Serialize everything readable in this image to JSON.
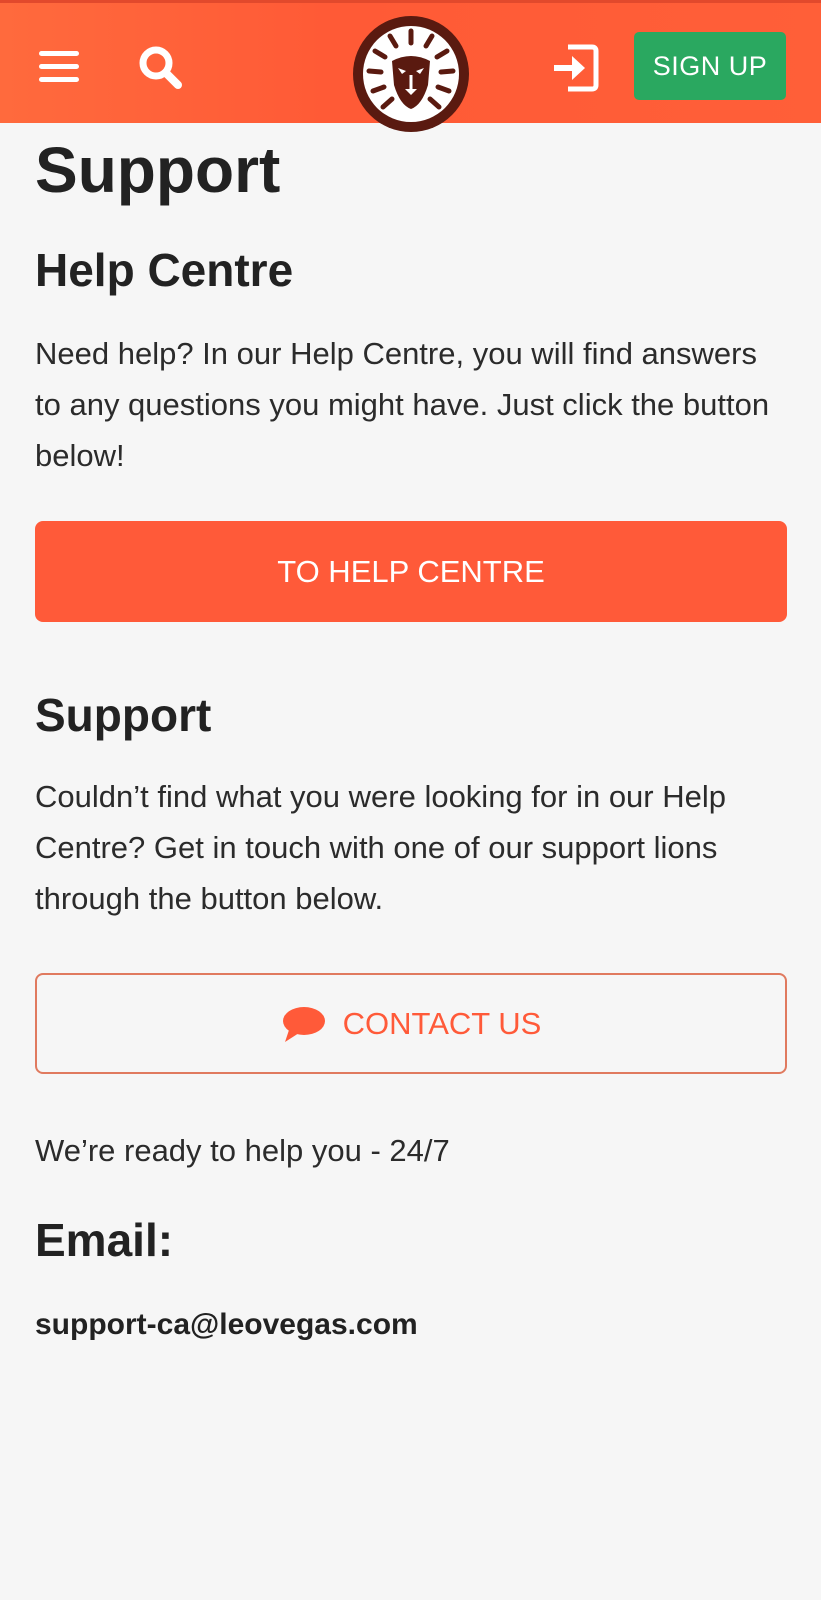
{
  "header": {
    "signup_label": "SIGN UP",
    "icons": {
      "menu": "hamburger-menu-icon",
      "search": "search-icon",
      "logo": "lion-logo",
      "login": "login-icon"
    },
    "colors": {
      "header_bg": "#ff5f38",
      "signup_bg": "#2aa860"
    }
  },
  "main": {
    "title": "Support",
    "help_centre": {
      "heading": "Help Centre",
      "text": "Need help? In our Help Centre, you will find answers to any questions you might have. Just click the button below!",
      "button_label": "TO HELP CENTRE"
    },
    "support": {
      "heading": "Support",
      "text": "Couldn’t find what you were looking for in our Help Centre? Get in touch with one of our support lions through the button below.",
      "button_label": "CONTACT US",
      "button_icon": "chat-bubble-icon"
    },
    "availability": "We’re ready to help you - 24/7",
    "email_heading": "Email:",
    "email_value": "support-ca@leovegas.com"
  },
  "colors": {
    "accent": "#ff5a39",
    "page_bg": "#f6f6f6",
    "text": "#222222"
  }
}
